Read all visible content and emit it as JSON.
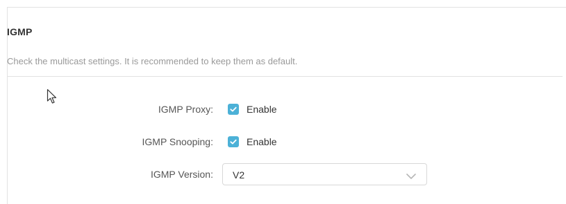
{
  "section": {
    "title": "IGMP",
    "description": "Check the multicast settings. It is recommended to keep them as default."
  },
  "igmp_proxy": {
    "label": "IGMP Proxy:",
    "checkbox_label": "Enable",
    "checked": true
  },
  "igmp_snooping": {
    "label": "IGMP Snooping:",
    "checkbox_label": "Enable",
    "checked": true
  },
  "igmp_version": {
    "label": "IGMP Version:",
    "selected": "V2"
  },
  "colors": {
    "checkbox_accent": "#4cb1d7",
    "title_text": "#333333",
    "description_text": "#999999",
    "border": "#e2e2e2"
  },
  "icons": {
    "checkbox_mark": "checkmark-icon",
    "select_arrow": "chevron-down-icon",
    "pointer": "mouse-cursor-icon"
  }
}
